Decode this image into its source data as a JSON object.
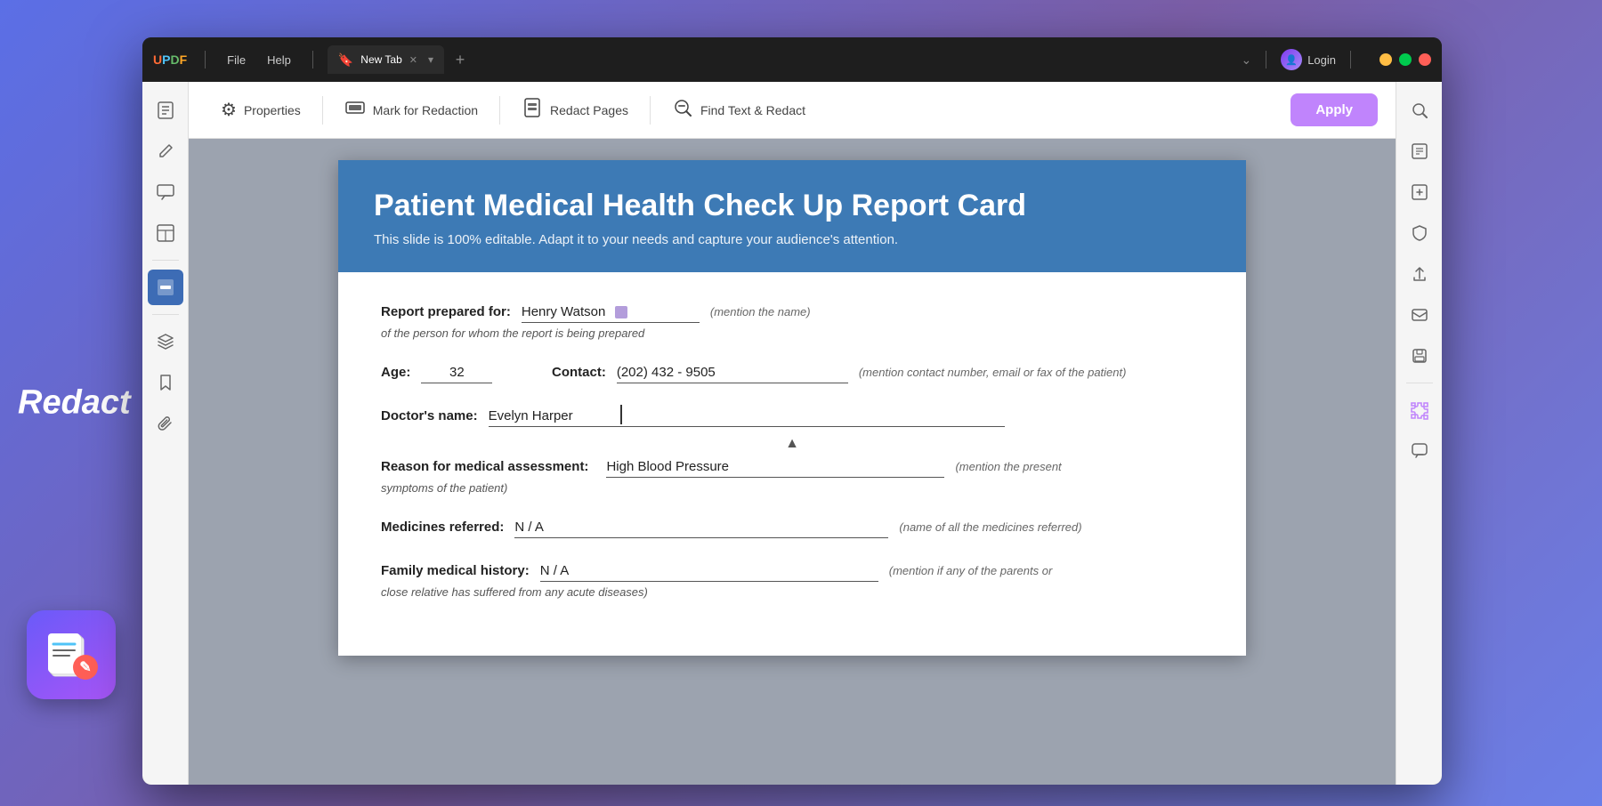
{
  "app": {
    "name": "UPDF",
    "logo_letters": [
      "U",
      "P",
      "D",
      "F"
    ]
  },
  "titlebar": {
    "menu_items": [
      "File",
      "Help"
    ],
    "tab_label": "New Tab",
    "tab_icon": "🔖",
    "login_label": "Login",
    "divider": "|"
  },
  "toolbar": {
    "properties_label": "Properties",
    "mark_redaction_label": "Mark for Redaction",
    "redact_pages_label": "Redact Pages",
    "find_text_label": "Find Text & Redact",
    "apply_label": "Apply"
  },
  "sidebar_left": {
    "icons": [
      {
        "name": "document-icon",
        "symbol": "☰"
      },
      {
        "name": "edit-icon",
        "symbol": "✏️"
      },
      {
        "name": "comment-icon",
        "symbol": "💬"
      },
      {
        "name": "table-icon",
        "symbol": "⊞"
      },
      {
        "name": "redact-icon",
        "symbol": "▓"
      },
      {
        "name": "layers-icon",
        "symbol": "◫"
      },
      {
        "name": "bookmark-icon",
        "symbol": "🔖"
      },
      {
        "name": "attachment-icon",
        "symbol": "📎"
      }
    ]
  },
  "sidebar_right": {
    "icons": [
      {
        "name": "search-right-icon",
        "symbol": "🔍"
      },
      {
        "name": "ocr-icon",
        "symbol": "⬚"
      },
      {
        "name": "compress-icon",
        "symbol": "⬡"
      },
      {
        "name": "protect-icon",
        "symbol": "🔒"
      },
      {
        "name": "share-icon",
        "symbol": "↑"
      },
      {
        "name": "mail-icon",
        "symbol": "✉"
      },
      {
        "name": "save-icon",
        "symbol": "💾"
      },
      {
        "name": "puzzle-icon",
        "symbol": "🧩"
      },
      {
        "name": "chat-icon",
        "symbol": "💬"
      }
    ]
  },
  "pdf": {
    "header": {
      "title": "Patient Medical Health Check Up Report Card",
      "subtitle": "This slide is 100% editable. Adapt it to your needs and capture your audience's attention."
    },
    "form": {
      "report_prepared_for_label": "Report prepared for:",
      "report_prepared_for_value": "Henry Watson",
      "report_prepared_for_hint": "(mention the name)",
      "report_prepared_for_subtext": "of the person for whom the report is being prepared",
      "age_label": "Age:",
      "age_value": "32",
      "contact_label": "Contact:",
      "contact_value": "(202) 432 - 9505",
      "contact_hint": "(mention contact number, email or fax of the patient)",
      "doctors_name_label": "Doctor's name:",
      "doctors_name_value": "Evelyn  Harper",
      "reason_label": "Reason for medical assessment:",
      "reason_value": "High Blood Pressure",
      "reason_hint": "(mention the present",
      "reason_subtext": "symptoms of the patient)",
      "medicines_label": "Medicines referred:",
      "medicines_value": "N / A",
      "medicines_hint": "(name of all the medicines referred)",
      "family_history_label": "Family medical history:",
      "family_history_value": "N / A",
      "family_history_hint": "(mention if any of the parents or",
      "family_history_subtext": "close relative has suffered from any acute diseases)"
    }
  },
  "redact_label": "Redact",
  "colors": {
    "apply_btn": "#c084fc",
    "pdf_header": "#3d7ab5",
    "redact_marker": "#b39ddb",
    "active_sidebar": "#3d6cb5"
  }
}
